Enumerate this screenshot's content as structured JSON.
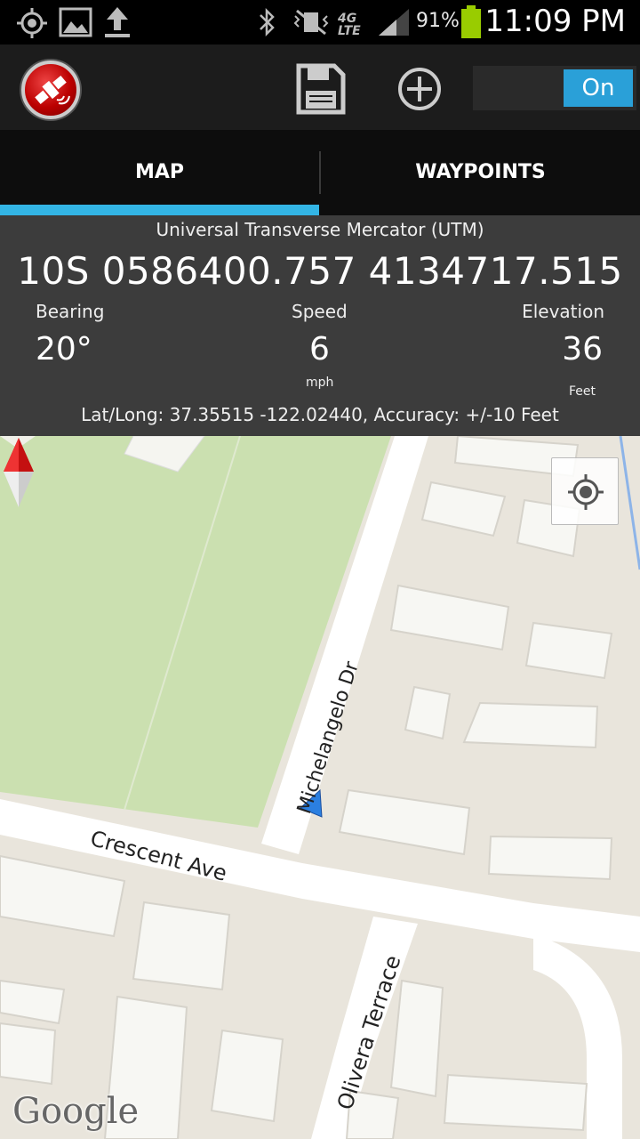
{
  "status_bar": {
    "battery_percent": "91%",
    "time": "11:09 PM",
    "network": "4G LTE"
  },
  "action_bar": {
    "toggle_label": "On"
  },
  "tabs": [
    {
      "label": "MAP",
      "active": true
    },
    {
      "label": "WAYPOINTS",
      "active": false
    }
  ],
  "info": {
    "coord_system": "Universal Transverse Mercator (UTM)",
    "coord_value": "10S 0586400.757 4134717.515",
    "bearing_label": "Bearing",
    "bearing_value": "20°",
    "speed_label": "Speed",
    "speed_value": "6",
    "speed_unit": "mph",
    "elevation_label": "Elevation",
    "elevation_value": "36",
    "elevation_unit": "Feet",
    "latlong": "Lat/Long: 37.35515 -122.02440, Accuracy: +/-10 Feet"
  },
  "map": {
    "streets": {
      "michelangelo": "Michelangelo Dr",
      "crescent": "Crescent Ave",
      "olivera": "Olivera Terrace"
    },
    "attribution": "Google"
  },
  "colors": {
    "accent": "#33b5e5",
    "toggle_on": "#2aa0d8",
    "park": "#cbe0b0",
    "map_bg": "#e9e5dc"
  }
}
